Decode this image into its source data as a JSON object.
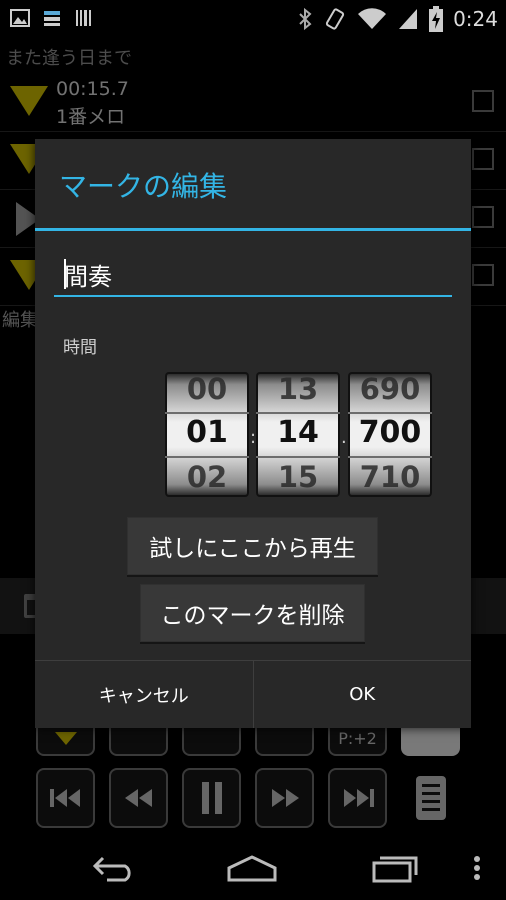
{
  "status_bar": {
    "time": "0:24",
    "left_icons": [
      "image-icon",
      "storage-icon",
      "barcode-icon"
    ],
    "right_icons": [
      "bluetooth-icon",
      "vibrate-icon",
      "wifi-icon",
      "signal-icon",
      "battery-icon"
    ]
  },
  "app": {
    "title": "また逢う日まで",
    "rows": [
      {
        "time": "00:15.7",
        "name": "1番メロ"
      }
    ],
    "edit_label": "編集",
    "controls": {
      "upper_badge": "P:+2"
    }
  },
  "dialog": {
    "title": "マークの編集",
    "name_value": "間奏",
    "time_label": "時間",
    "pickers": [
      {
        "prev": "00",
        "current": "01",
        "next": "02"
      },
      {
        "prev": "13",
        "current": "14",
        "next": "15"
      },
      {
        "prev": "690",
        "current": "700",
        "next": "710"
      }
    ],
    "separators": [
      ":",
      "."
    ],
    "try_button": "試しにここから再生",
    "delete_button": "このマークを削除",
    "cancel_button": "キャンセル",
    "ok_button": "OK"
  },
  "colors": {
    "accent": "#33b5e5",
    "mark_triangle": "#c7b700",
    "dialog_bg": "#282828"
  }
}
